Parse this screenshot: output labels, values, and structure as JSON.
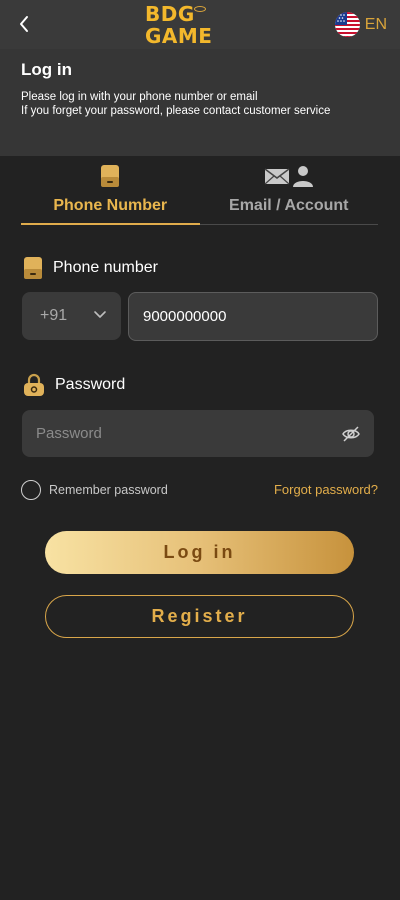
{
  "topbar": {
    "logo_text": "BDG GAME",
    "language": "EN"
  },
  "header": {
    "title": "Log in",
    "line1": "Please log in with your phone number or email",
    "line2": "If you forget your password, please contact customer service"
  },
  "tabs": [
    {
      "label": "Phone Number",
      "active": true
    },
    {
      "label": "Email / Account",
      "active": false
    }
  ],
  "phone": {
    "label": "Phone number",
    "country_code": "+91",
    "value": "9000000000"
  },
  "password": {
    "label": "Password",
    "placeholder": "Password",
    "value": ""
  },
  "remember": {
    "label": "Remember password",
    "checked": false
  },
  "forgot_label": "Forgot password?",
  "buttons": {
    "login": "Log in",
    "register": "Register"
  },
  "colors": {
    "background": "#222222",
    "topbar": "#3a3a3a",
    "accent_gold": "#e3ae4b",
    "input_bg": "#3a3a3a"
  },
  "icons": [
    "back-arrow-icon",
    "us-flag-icon",
    "phone-icon",
    "email-icon",
    "user-icon",
    "lock-icon",
    "eye-off-icon",
    "chevron-down-icon"
  ]
}
